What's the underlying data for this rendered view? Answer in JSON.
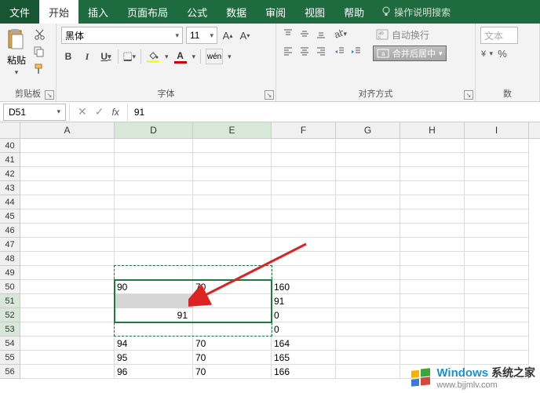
{
  "tabs": {
    "file": "文件",
    "home": "开始",
    "insert": "插入",
    "layout": "页面布局",
    "formulas": "公式",
    "data": "数据",
    "review": "审阅",
    "view": "视图",
    "help": "帮助",
    "tellme": "操作说明搜索"
  },
  "ribbon": {
    "clipboard": {
      "label": "剪贴板",
      "paste": "粘贴"
    },
    "font": {
      "label": "字体",
      "name": "黑体",
      "size": "11",
      "bold": "B",
      "italic": "I",
      "underline": "U",
      "ruby": "wén"
    },
    "align": {
      "label": "对齐方式",
      "wrap": "自动换行",
      "merge": "合并后居中"
    },
    "number": {
      "label": "数",
      "format": "文本",
      "percent": "%"
    }
  },
  "formula_bar": {
    "cell_ref": "D51",
    "value": "91",
    "fx": "fx"
  },
  "columns": [
    "A",
    "D",
    "E",
    "F",
    "G",
    "H",
    "I"
  ],
  "row_start": 40,
  "row_end": 56,
  "cells": {
    "50": {
      "D": "90",
      "E": "70",
      "F": "160"
    },
    "51": {
      "F": "91"
    },
    "52": {
      "D": "91",
      "F": "0"
    },
    "53": {
      "F": "0"
    },
    "54": {
      "D": "94",
      "E": "70",
      "F": "164"
    },
    "55": {
      "D": "95",
      "E": "70",
      "F": "165"
    },
    "56": {
      "D": "96",
      "E": "70",
      "F": "166"
    }
  },
  "selection": {
    "active": "D51",
    "highlight_cell": "D52"
  },
  "watermark": {
    "brand": "Windows",
    "suffix": "系统之家",
    "url": "www.bjjmlv.com"
  }
}
